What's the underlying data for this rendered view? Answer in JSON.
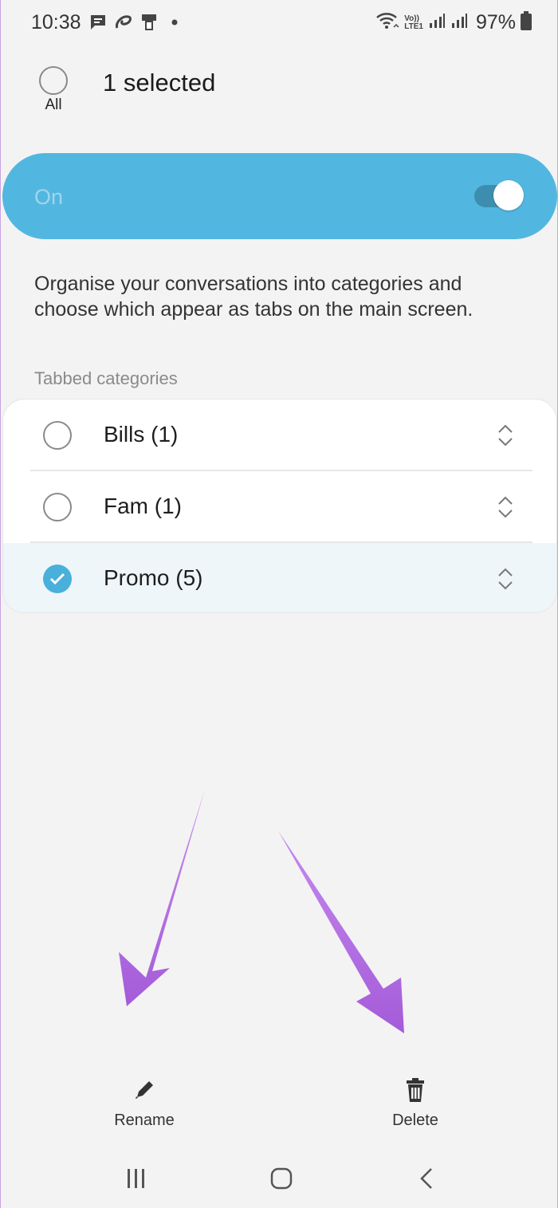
{
  "status_bar": {
    "time": "10:38",
    "battery": "97%",
    "icons": [
      "message-icon",
      "airtel-icon",
      "mobile-icon",
      "dot-icon",
      "wifi-icon",
      "volte-icon",
      "signal-icon",
      "signal-icon",
      "battery-icon"
    ],
    "volte_line1": "Vo))",
    "volte_line2": "LTE1"
  },
  "header": {
    "select_all_label": "All",
    "title": "1 selected"
  },
  "master_switch": {
    "label": "On",
    "checked": true,
    "color": "#52b7e0"
  },
  "description": "Organise your conversations into categories and choose which appear as tabs on the main screen.",
  "section_header": "Tabbed categories",
  "categories": [
    {
      "label": "Bills (1)",
      "selected": false
    },
    {
      "label": "Fam (1)",
      "selected": false
    },
    {
      "label": "Promo (5)",
      "selected": true
    }
  ],
  "actions": {
    "rename_label": "Rename",
    "delete_label": "Delete"
  },
  "colors": {
    "accent": "#48b0db",
    "annotation_arrow": "#b873e6"
  }
}
